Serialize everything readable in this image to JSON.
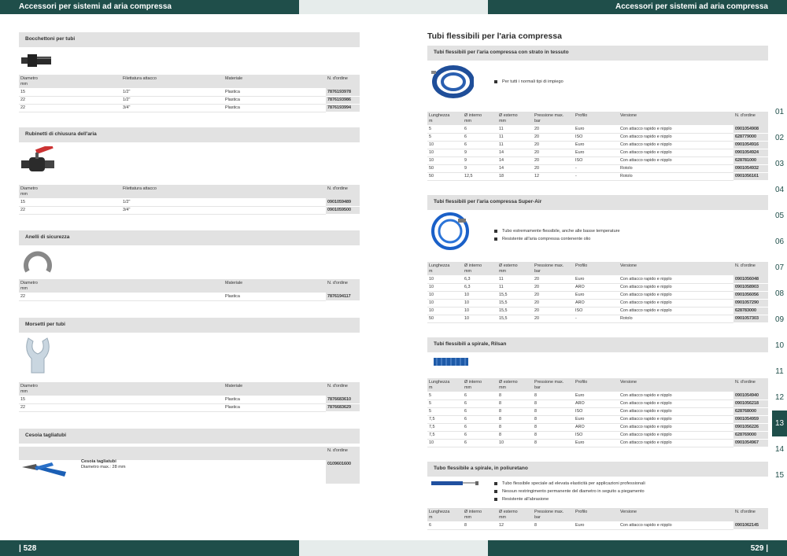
{
  "header": {
    "left": "Accessori per sistemi ad aria compressa",
    "right": "Accessori per sistemi ad aria compressa"
  },
  "footer": {
    "left": "| 528",
    "right": "529 |"
  },
  "left": {
    "s1": {
      "title": "Bocchettoni per tubi",
      "h": [
        "Diametro\nmm",
        "Filettatura attacco",
        "Materiale",
        "N. d'ordine"
      ],
      "rows": [
        [
          "15",
          "1/2\"",
          "Plastica",
          "7876193978"
        ],
        [
          "22",
          "1/2\"",
          "Plastica",
          "7876193986"
        ],
        [
          "22",
          "3/4\"",
          "Plastica",
          "7876193994"
        ]
      ]
    },
    "s2": {
      "title": "Rubinetti di chiusura dell'aria",
      "h": [
        "Diametro\nmm",
        "Filettatura attacco",
        "N. d'ordine"
      ],
      "rows": [
        [
          "15",
          "1/2\"",
          "0901059489"
        ],
        [
          "22",
          "3/4\"",
          "0901059500"
        ]
      ]
    },
    "s3": {
      "title": "Anelli di sicurezza",
      "h": [
        "Diametro\nmm",
        "Materiale",
        "N. d'ordine"
      ],
      "rows": [
        [
          "22",
          "Plastica",
          "7876194117"
        ]
      ]
    },
    "s4": {
      "title": "Morsetti per tubi",
      "h": [
        "Diametro\nmm",
        "Materiale",
        "N. d'ordine"
      ],
      "rows": [
        [
          "15",
          "Plastica",
          "7876683610"
        ],
        [
          "22",
          "Plastica",
          "7876683629"
        ]
      ]
    },
    "s5": {
      "title": "Cesoia tagliatubi",
      "h": "N. d'ordine",
      "name": "Cesoia tagliatubi",
      "desc": "Diametro max.: 28 mm",
      "order": "0109601600"
    }
  },
  "right": {
    "title": "Tubi flessibili per l'aria compressa",
    "cols": [
      "Lunghezza\nm",
      "Ø interno\nmm",
      "Ø esterno\nmm",
      "Pressione max.\nbar",
      "Profilo",
      "Versione",
      "N. d'ordine"
    ],
    "s1": {
      "title": "Tubi flessibili per l'aria compressa con strato in tessuto",
      "bullets": [
        "Per tutti i normali tipi di impiego"
      ],
      "rows": [
        [
          "5",
          "6",
          "11",
          "20",
          "Euro",
          "Con attacco rapido e nipplo",
          "0901054908"
        ],
        [
          "5",
          "6",
          "11",
          "20",
          "ISO",
          "Con attacco rapido e nipplo",
          "628779000"
        ],
        [
          "10",
          "6",
          "11",
          "20",
          "Euro",
          "Con attacco rapido e nipplo",
          "0901054916"
        ],
        [
          "10",
          "9",
          "14",
          "20",
          "Euro",
          "Con attacco rapido e nipplo",
          "0901054924"
        ],
        [
          "10",
          "9",
          "14",
          "20",
          "ISO",
          "Con attacco rapido e nipplo",
          "628781000"
        ],
        [
          "50",
          "9",
          "14",
          "20",
          "-",
          "Rotolo",
          "0901054932"
        ],
        [
          "50",
          "12,5",
          "18",
          "12",
          "-",
          "Rotolo",
          "0901056161"
        ]
      ]
    },
    "s2": {
      "title": "Tubi flessibili per l'aria compressa Super-Air",
      "bullets": [
        "Tubo estremamente flessibile, anche alle basse temperature",
        "Resistente all'aria compressa contenente olio"
      ],
      "rows": [
        [
          "10",
          "6,3",
          "11",
          "20",
          "Euro",
          "Con attacco rapido e nipplo",
          "0901056048"
        ],
        [
          "10",
          "6,3",
          "11",
          "20",
          "ARO",
          "Con attacco rapido e nipplo",
          "0901058903"
        ],
        [
          "10",
          "10",
          "15,5",
          "20",
          "Euro",
          "Con attacco rapido e nipplo",
          "0901056056"
        ],
        [
          "10",
          "10",
          "15,5",
          "20",
          "ARO",
          "Con attacco rapido e nipplo",
          "0901057290"
        ],
        [
          "10",
          "10",
          "15,5",
          "20",
          "ISO",
          "Con attacco rapido e nipplo",
          "628783000"
        ],
        [
          "50",
          "10",
          "15,5",
          "20",
          "-",
          "Rotolo",
          "0901057303"
        ]
      ]
    },
    "s3": {
      "title": "Tubi flessibili a spirale, Rilsan",
      "rows": [
        [
          "5",
          "6",
          "8",
          "8",
          "Euro",
          "Con attacco rapido e nipplo",
          "0901054940"
        ],
        [
          "5",
          "6",
          "8",
          "8",
          "ARO",
          "Con attacco rapido e nipplo",
          "0901056218"
        ],
        [
          "5",
          "6",
          "8",
          "8",
          "ISO",
          "Con attacco rapido e nipplo",
          "628768000"
        ],
        [
          "7,5",
          "6",
          "8",
          "8",
          "Euro",
          "Con attacco rapido e nipplo",
          "0901054959"
        ],
        [
          "7,5",
          "6",
          "8",
          "8",
          "ARO",
          "Con attacco rapido e nipplo",
          "0901056226"
        ],
        [
          "7,5",
          "6",
          "8",
          "8",
          "ISO",
          "Con attacco rapido e nipplo",
          "628769000"
        ],
        [
          "10",
          "6",
          "10",
          "8",
          "Euro",
          "Con attacco rapido e nipplo",
          "0901054967"
        ]
      ]
    },
    "s4": {
      "title": "Tubo flessibile a spirale, in poliuretano",
      "bullets": [
        "Tubo flessibile speciale ad elevata elasticità per applicazioni professionali",
        "Nessun restringimento permanente del diametro in seguito a piegamento",
        "Resistente all'abrasione"
      ],
      "rows": [
        [
          "6",
          "8",
          "12",
          "8",
          "Euro",
          "Con attacco rapido e nipplo",
          "0901062145"
        ]
      ]
    }
  },
  "tabs": [
    "01",
    "02",
    "03",
    "04",
    "05",
    "06",
    "07",
    "08",
    "09",
    "10",
    "11",
    "12",
    "13",
    "14",
    "15"
  ],
  "active_tab": "13"
}
